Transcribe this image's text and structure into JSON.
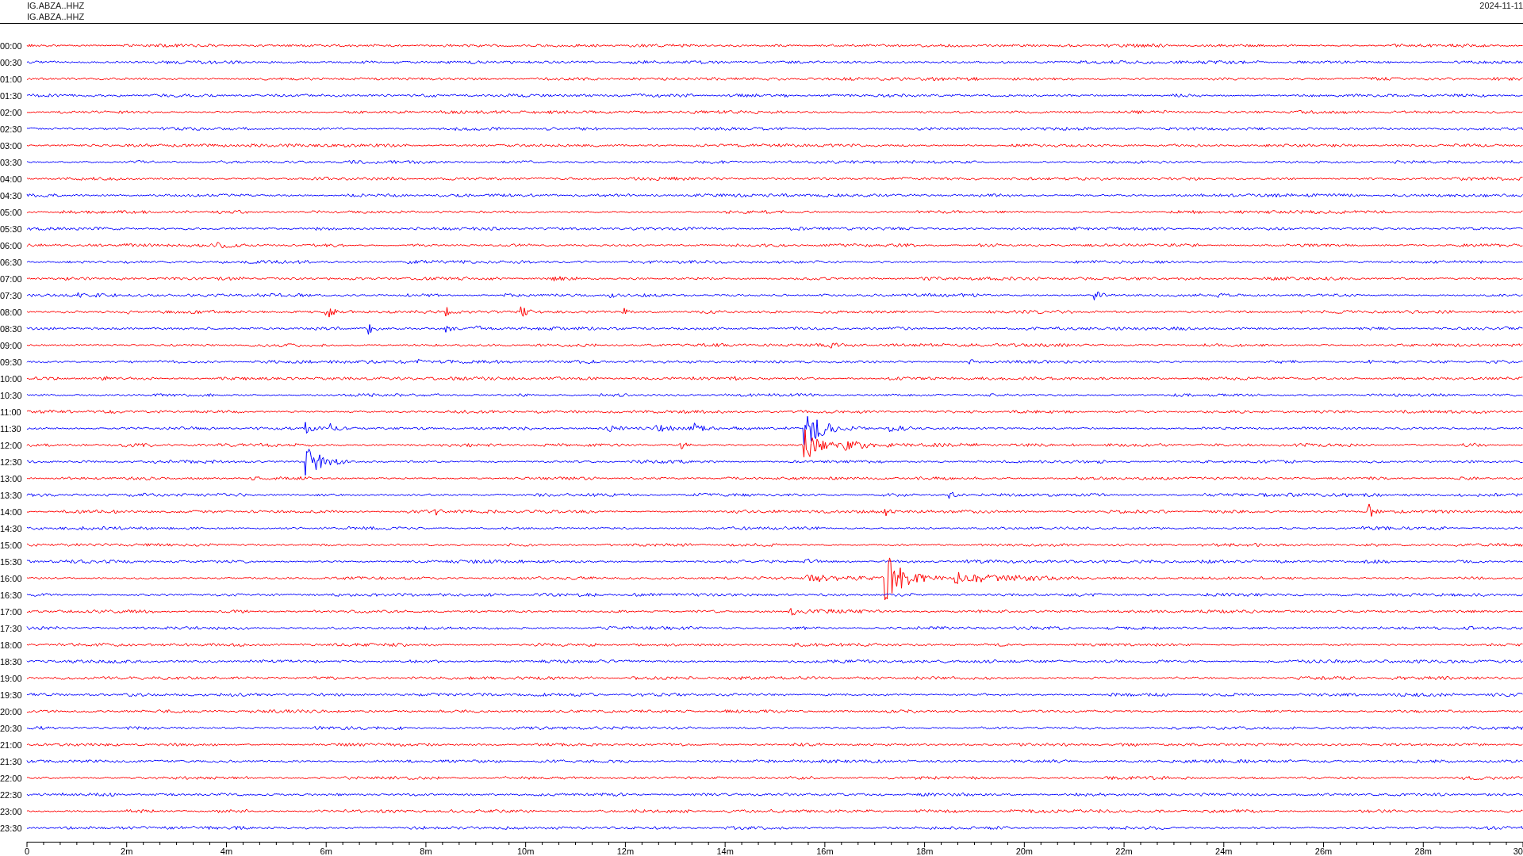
{
  "header": {
    "station_lines": [
      "IG.ABZA..HHZ",
      "IG.ABZA..HHZ"
    ],
    "date": "2024-11-11"
  },
  "rows": [
    {
      "label": "00:00",
      "color": "#ff0000"
    },
    {
      "label": "00:30",
      "color": "#0000ff"
    },
    {
      "label": "01:00",
      "color": "#ff0000"
    },
    {
      "label": "01:30",
      "color": "#0000ff"
    },
    {
      "label": "02:00",
      "color": "#ff0000"
    },
    {
      "label": "02:30",
      "color": "#0000ff"
    },
    {
      "label": "03:00",
      "color": "#ff0000"
    },
    {
      "label": "03:30",
      "color": "#0000ff"
    },
    {
      "label": "04:00",
      "color": "#ff0000"
    },
    {
      "label": "04:30",
      "color": "#0000ff"
    },
    {
      "label": "05:00",
      "color": "#ff0000"
    },
    {
      "label": "05:30",
      "color": "#0000ff"
    },
    {
      "label": "06:00",
      "color": "#ff0000"
    },
    {
      "label": "06:30",
      "color": "#0000ff"
    },
    {
      "label": "07:00",
      "color": "#ff0000"
    },
    {
      "label": "07:30",
      "color": "#0000ff"
    },
    {
      "label": "08:00",
      "color": "#ff0000"
    },
    {
      "label": "08:30",
      "color": "#0000ff"
    },
    {
      "label": "09:00",
      "color": "#ff0000"
    },
    {
      "label": "09:30",
      "color": "#0000ff"
    },
    {
      "label": "10:00",
      "color": "#ff0000"
    },
    {
      "label": "10:30",
      "color": "#0000ff"
    },
    {
      "label": "11:00",
      "color": "#ff0000"
    },
    {
      "label": "11:30",
      "color": "#0000ff"
    },
    {
      "label": "12:00",
      "color": "#ff0000"
    },
    {
      "label": "12:30",
      "color": "#0000ff"
    },
    {
      "label": "13:00",
      "color": "#ff0000"
    },
    {
      "label": "13:30",
      "color": "#0000ff"
    },
    {
      "label": "14:00",
      "color": "#ff0000"
    },
    {
      "label": "14:30",
      "color": "#0000ff"
    },
    {
      "label": "15:00",
      "color": "#ff0000"
    },
    {
      "label": "15:30",
      "color": "#0000ff"
    },
    {
      "label": "16:00",
      "color": "#ff0000"
    },
    {
      "label": "16:30",
      "color": "#0000ff"
    },
    {
      "label": "17:00",
      "color": "#ff0000"
    },
    {
      "label": "17:30",
      "color": "#0000ff"
    },
    {
      "label": "18:00",
      "color": "#ff0000"
    },
    {
      "label": "18:30",
      "color": "#0000ff"
    },
    {
      "label": "19:00",
      "color": "#ff0000"
    },
    {
      "label": "19:30",
      "color": "#0000ff"
    },
    {
      "label": "20:00",
      "color": "#ff0000"
    },
    {
      "label": "20:30",
      "color": "#0000ff"
    },
    {
      "label": "21:00",
      "color": "#ff0000"
    },
    {
      "label": "21:30",
      "color": "#0000ff"
    },
    {
      "label": "22:00",
      "color": "#ff0000"
    },
    {
      "label": "22:30",
      "color": "#0000ff"
    },
    {
      "label": "23:00",
      "color": "#ff0000"
    },
    {
      "label": "23:30",
      "color": "#0000ff"
    }
  ],
  "time_axis": {
    "labels": [
      "0",
      "2m",
      "4m",
      "6m",
      "8m",
      "10m",
      "12m",
      "14m",
      "16m",
      "18m",
      "20m",
      "22m",
      "24m",
      "26m",
      "28m",
      "30"
    ]
  }
}
